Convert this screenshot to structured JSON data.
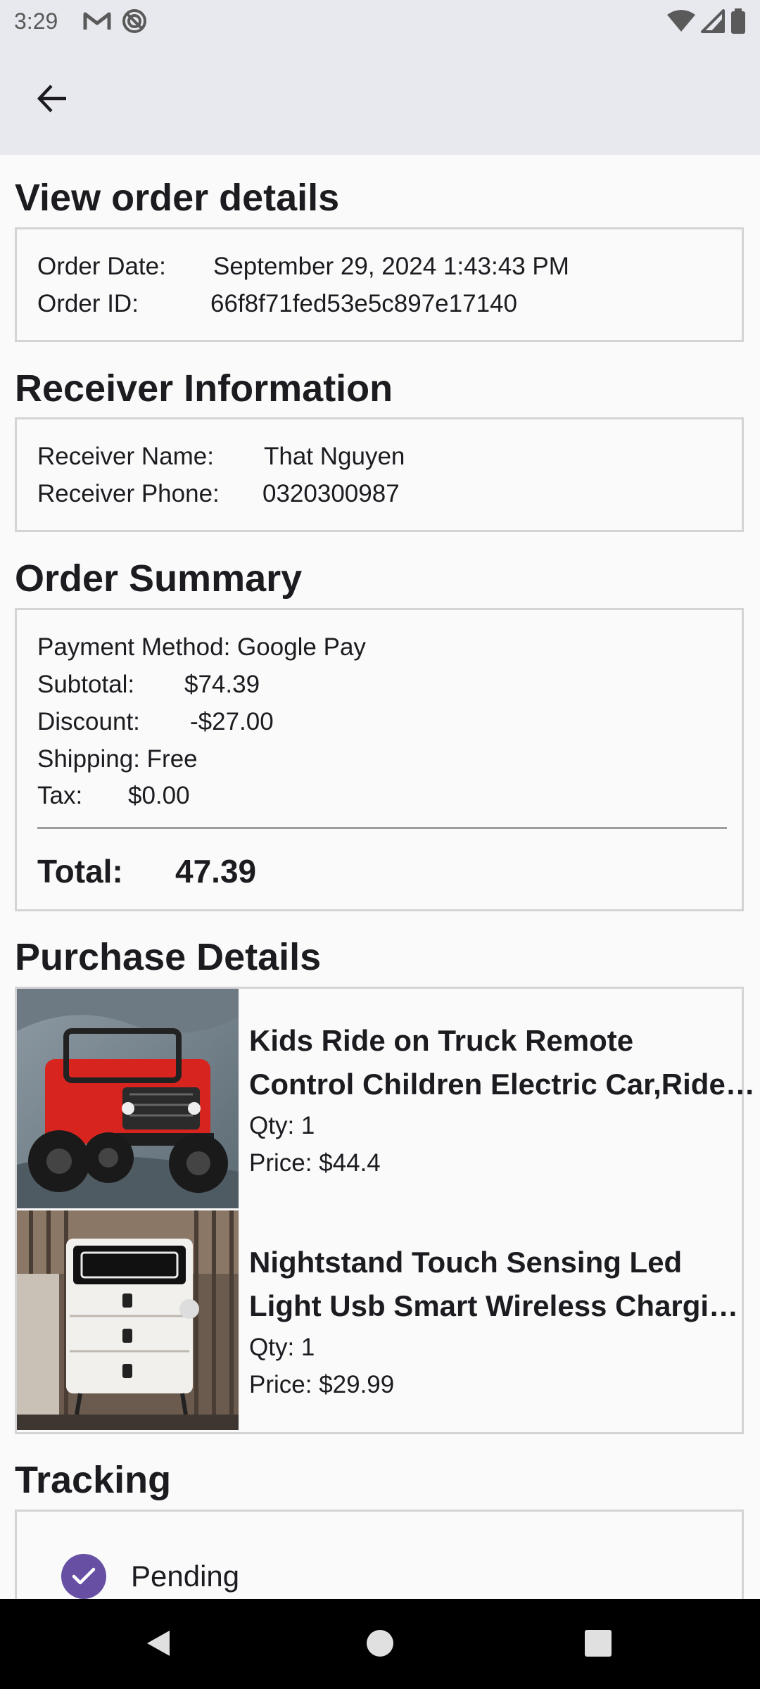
{
  "status_bar": {
    "time": "3:29",
    "left_icons": [
      "gmail-icon",
      "do-not-disturb-icon"
    ],
    "right_icons": [
      "wifi-icon",
      "signal-icon",
      "battery-icon"
    ]
  },
  "app_bar": {
    "back_icon": "arrow-back-icon"
  },
  "order_details": {
    "title": "View order details",
    "date_label": "Order Date:",
    "date_value": "September 29, 2024 1:43:43 PM",
    "id_label": "Order ID:",
    "id_value": "66f8f71fed53e5c897e17140"
  },
  "receiver": {
    "title": "Receiver Information",
    "name_label": "Receiver Name:",
    "name_value": "That Nguyen",
    "phone_label": "Receiver Phone:",
    "phone_value": "0320300987"
  },
  "summary": {
    "title": "Order Summary",
    "payment": "Payment Method: Google Pay",
    "subtotal_label": "Subtotal:",
    "subtotal_value": "$74.39",
    "discount_label": "Discount:",
    "discount_value": "-$27.00",
    "shipping": "Shipping: Free",
    "tax_label": "Tax:",
    "tax_value": "$0.00",
    "total_label": "Total:",
    "total_value": "47.39"
  },
  "purchase": {
    "title": "Purchase Details",
    "items": [
      {
        "title_line1": "Kids Ride on Truck Remote",
        "title_line2": "Control Children Electric Car,Ride On Truck",
        "qty": "Qty: 1",
        "price": "Price: $44.4"
      },
      {
        "title_line1": "Nightstand Touch Sensing Led",
        "title_line2": "Light Usb Smart Wireless Charging Bedside Table",
        "qty": "Qty: 1",
        "price": "Price: $29.99"
      }
    ]
  },
  "tracking": {
    "title": "Tracking",
    "steps": [
      {
        "label": "Pending",
        "done": true
      }
    ]
  },
  "colors": {
    "accent": "#6750a4",
    "app_bar": "#e8e9ee",
    "background": "#fafafb",
    "border": "#d4d4d6"
  }
}
